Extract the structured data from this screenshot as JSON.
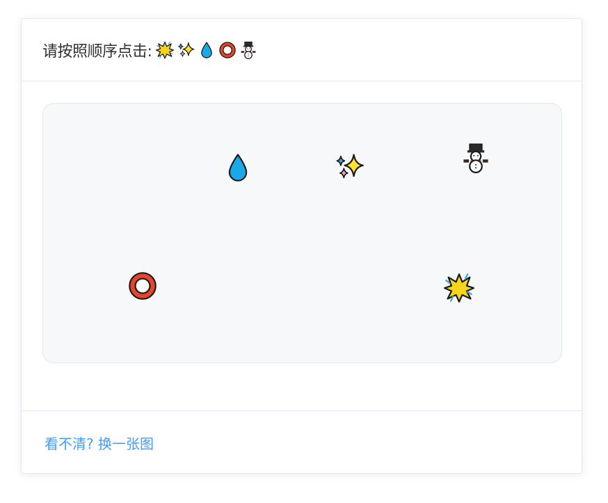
{
  "header": {
    "instruction": "请按照顺序点击:",
    "sequence": [
      {
        "icon": "collision-icon"
      },
      {
        "icon": "sparkles-icon"
      },
      {
        "icon": "droplet-icon"
      },
      {
        "icon": "ring-icon"
      },
      {
        "icon": "snowman-icon"
      }
    ]
  },
  "canvas": {
    "targets": [
      {
        "icon": "droplet-icon"
      },
      {
        "icon": "sparkles-icon"
      },
      {
        "icon": "snowman-icon"
      },
      {
        "icon": "ring-icon"
      },
      {
        "icon": "collision-icon"
      }
    ]
  },
  "footer": {
    "refresh_label": "看不清? 换一张图"
  },
  "colors": {
    "link": "#409eff",
    "panel_bg": "#f7f8fa",
    "border": "#e4e7ed",
    "text": "#303133"
  }
}
